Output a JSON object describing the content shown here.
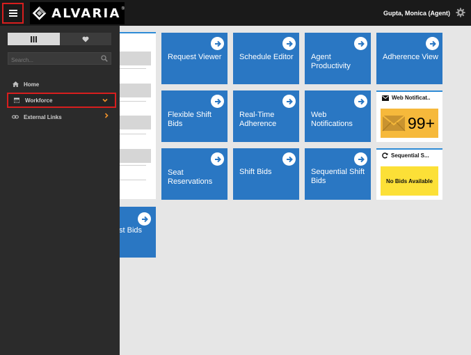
{
  "header": {
    "logo_text": "ALVARIA",
    "logo_mark": "®",
    "user": "Gupta, Monica (Agent)",
    "icons": {
      "menu": "hamburger-icon",
      "settings": "gear-icon"
    }
  },
  "sidebar": {
    "toggle_icons": [
      "columns-icon",
      "heart-icon"
    ],
    "search": {
      "placeholder": "Search...",
      "value": ""
    },
    "items": [
      {
        "label": "Home",
        "icon": "home-icon"
      },
      {
        "label": "Workforce",
        "icon": "calendar-icon",
        "state": "expanded"
      },
      {
        "label": "External Links",
        "icon": "link-icon"
      }
    ]
  },
  "tiles": [
    {
      "label": "Request Viewer"
    },
    {
      "label": "Schedule Editor"
    },
    {
      "label": "Agent Productivity"
    },
    {
      "label": "Adherence View"
    },
    {
      "label": "Flexible Shift Bids"
    },
    {
      "label": "Real-Time Adherence"
    },
    {
      "label": "Web Notifications"
    },
    {
      "label": "Seat Reservations"
    },
    {
      "label": "Shift Bids"
    },
    {
      "label": "Sequential Shift Bids"
    },
    {
      "label": "st Bids"
    }
  ],
  "widgets": {
    "notifications": {
      "title": "Web Notificat..",
      "count": "99+",
      "icon": "envelope-icon"
    },
    "sequential": {
      "title": "Sequential S...",
      "message": "No Bids Available",
      "icon": "refresh-icon"
    }
  },
  "colors": {
    "tile": "#2a77c3",
    "highlight": "#d81e1e",
    "accent": "#f0922b",
    "notification_bg": "#f6b93b",
    "no_bids_bg": "#fce037"
  }
}
